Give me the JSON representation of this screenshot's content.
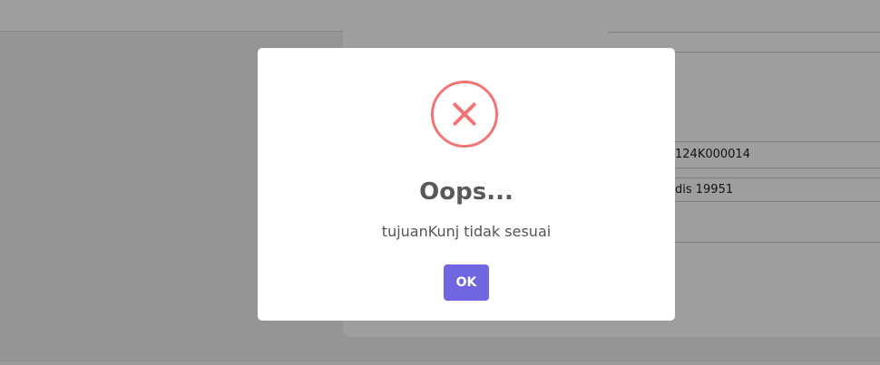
{
  "background": {
    "rows": [
      {
        "text": "124K000014"
      },
      {
        "text": "dis 19951"
      }
    ]
  },
  "dialog": {
    "icon": "error-x-icon",
    "icon_color": "#f27474",
    "title": "Oops...",
    "message": "tujuanKunj tidak sesuai",
    "ok_label": "OK",
    "button_color": "#7066e0"
  }
}
